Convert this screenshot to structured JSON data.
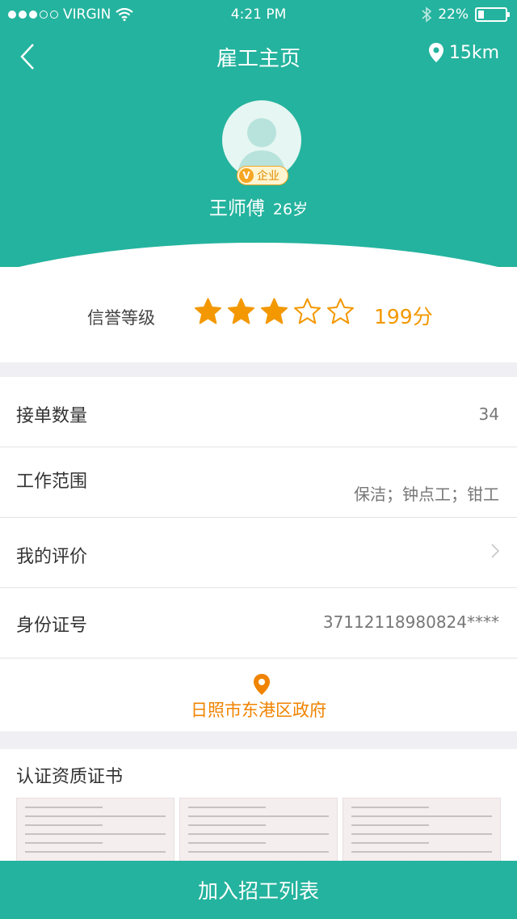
{
  "status_bar": {
    "carrier": "VIRGIN",
    "time": "4:21 PM",
    "battery": "22%",
    "battery_level": 0.22
  },
  "nav": {
    "title": "雇工主页",
    "distance": "15km"
  },
  "profile": {
    "badge_letter": "V",
    "badge_text": "企业",
    "name": "王师傅",
    "age": "26岁"
  },
  "credit": {
    "label": "信誉等级",
    "stars_filled": 3,
    "stars_total": 5,
    "score": "199分"
  },
  "rows": [
    {
      "label": "接单数量",
      "value": "34"
    },
    {
      "label": "工作范围",
      "value": "保洁；钟点工；钳工"
    },
    {
      "label": "我的评价",
      "value": ""
    },
    {
      "label": "身份证号",
      "value": "37112118980824****"
    }
  ],
  "address": "日照市东港区政府",
  "certificates": {
    "title": "认证资质证书",
    "count": 3
  },
  "bottom_button": "加入招工列表",
  "colors": {
    "primary": "#24b39e",
    "accent": "#f39800",
    "background": "#efeff4"
  }
}
